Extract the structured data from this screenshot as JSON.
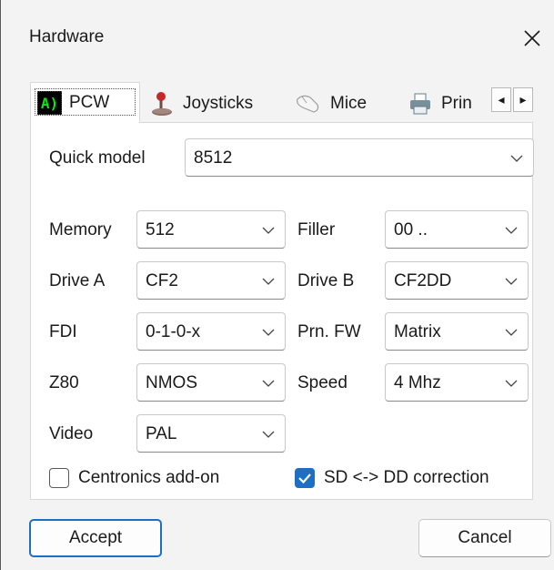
{
  "window": {
    "title": "Hardware"
  },
  "tabs": [
    {
      "label": "PCW",
      "icon": "terminal-icon",
      "active": true
    },
    {
      "label": "Joysticks",
      "icon": "joystick-icon"
    },
    {
      "label": "Mice",
      "icon": "mouse-icon"
    },
    {
      "label": "Prin",
      "icon": "printer-icon"
    }
  ],
  "tab_scroll": {
    "left": "◂",
    "right": "▸"
  },
  "tab_icon_text": "A)",
  "quick_model": {
    "label": "Quick model",
    "value": "8512"
  },
  "fields": {
    "memory": {
      "label": "Memory",
      "value": "512"
    },
    "filler": {
      "label": "Filler",
      "value": "00 .."
    },
    "drive_a": {
      "label": "Drive A",
      "value": "CF2"
    },
    "drive_b": {
      "label": "Drive B",
      "value": "CF2DD"
    },
    "fdi": {
      "label": "FDI",
      "value": "0-1-0-x"
    },
    "prn_fw": {
      "label": "Prn. FW",
      "value": "Matrix"
    },
    "z80": {
      "label": "Z80",
      "value": "NMOS"
    },
    "speed": {
      "label": "Speed",
      "value": "4 Mhz"
    },
    "video": {
      "label": "Video",
      "value": "PAL"
    }
  },
  "checkboxes": {
    "centronics": {
      "label": "Centronics add-on",
      "checked": false
    },
    "sd_dd": {
      "label": "SD <-> DD correction",
      "checked": true
    }
  },
  "buttons": {
    "accept": "Accept",
    "cancel": "Cancel"
  },
  "colors": {
    "accent": "#1d6fc4",
    "window_bg": "#f3f3f3",
    "panel_bg": "#ffffff"
  }
}
